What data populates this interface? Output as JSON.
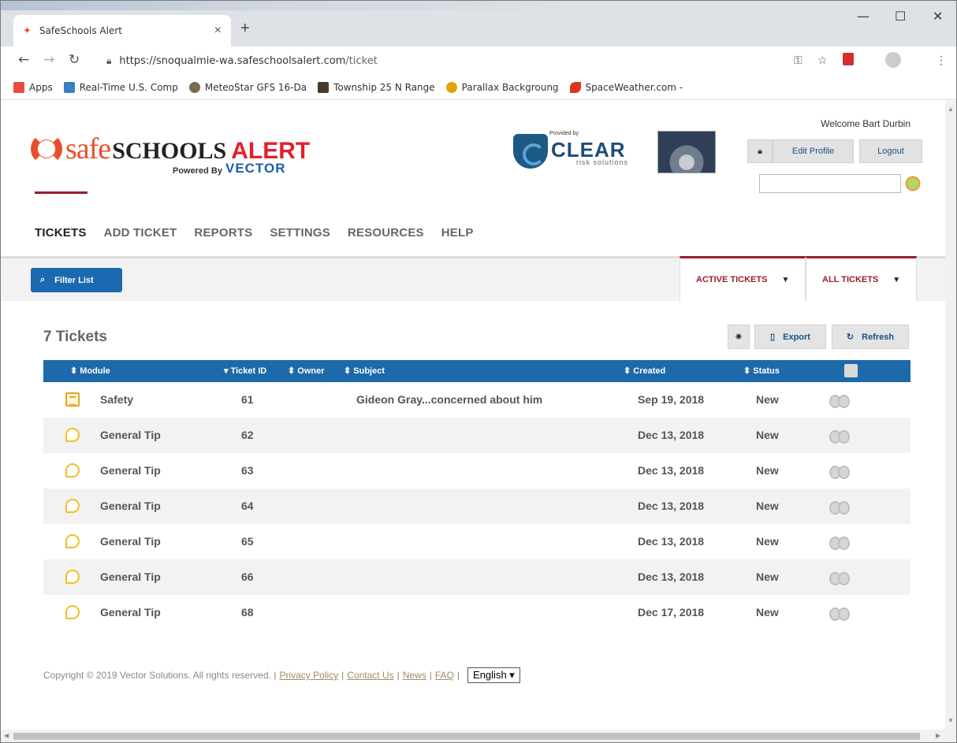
{
  "browser": {
    "tab_title": "SafeSchools Alert",
    "url_host": "https://snoqualmie-wa.safeschoolsalert.com",
    "url_path": "/ticket",
    "bookmarks": [
      {
        "label": "Apps",
        "color": "#e94b3c"
      },
      {
        "label": "Real-Time U.S. Comp",
        "color": "#3c7fc2"
      },
      {
        "label": "MeteoStar GFS 16-Da",
        "color": "#7a6a55"
      },
      {
        "label": "Township 25 N Range",
        "color": "#4a3a2a"
      },
      {
        "label": "Parallax Backgroung",
        "color": "#e2a400"
      },
      {
        "label": "SpaceWeather.com -",
        "color": "#d9361e"
      }
    ]
  },
  "header": {
    "logo_safe": "safe",
    "logo_schools": "SCHOOLS",
    "logo_alert": "ALERT",
    "powered_by": "Powered By",
    "vector": "VECTOR",
    "provided_by": "Provided by",
    "clear": "CLEAR",
    "risk": "risk solutions",
    "welcome": "Welcome Bart Durbin",
    "edit_profile": "Edit Profile",
    "logout": "Logout"
  },
  "nav": {
    "items": [
      "TICKETS",
      "ADD TICKET",
      "REPORTS",
      "SETTINGS",
      "RESOURCES",
      "HELP"
    ]
  },
  "subbar": {
    "filter_label": "Filter List",
    "active_tickets": "ACTIVE TICKETS",
    "all_tickets": "ALL TICKETS"
  },
  "list": {
    "count_label": "7 Tickets",
    "export_label": "Export",
    "refresh_label": "Refresh",
    "columns": {
      "module": "Module",
      "ticket_id": "Ticket ID",
      "owner": "Owner",
      "subject": "Subject",
      "created": "Created",
      "status": "Status"
    },
    "rows": [
      {
        "module": "Safety",
        "icon": "safety-icon",
        "id": "61",
        "owner": "",
        "subject": "Gideon Gray...concerned about him",
        "created": "Sep 19, 2018",
        "status": "New"
      },
      {
        "module": "General Tip",
        "icon": "speech-bubble-icon",
        "id": "62",
        "owner": "",
        "subject": "",
        "created": "Dec 13, 2018",
        "status": "New"
      },
      {
        "module": "General Tip",
        "icon": "speech-bubble-icon",
        "id": "63",
        "owner": "",
        "subject": "",
        "created": "Dec 13, 2018",
        "status": "New"
      },
      {
        "module": "General Tip",
        "icon": "speech-bubble-icon",
        "id": "64",
        "owner": "",
        "subject": "",
        "created": "Dec 13, 2018",
        "status": "New"
      },
      {
        "module": "General Tip",
        "icon": "speech-bubble-icon",
        "id": "65",
        "owner": "",
        "subject": "",
        "created": "Dec 13, 2018",
        "status": "New"
      },
      {
        "module": "General Tip",
        "icon": "speech-bubble-icon",
        "id": "66",
        "owner": "",
        "subject": "",
        "created": "Dec 13, 2018",
        "status": "New"
      },
      {
        "module": "General Tip",
        "icon": "speech-bubble-icon",
        "id": "68",
        "owner": "",
        "subject": "",
        "created": "Dec 17, 2018",
        "status": "New"
      }
    ]
  },
  "footer": {
    "copyright": "Copyright © 2019 Vector Solutions. All rights reserved. |",
    "privacy": "Privacy Policy",
    "contact": "Contact Us",
    "news": "News",
    "faq": "FAQ",
    "language": "English"
  },
  "colors": {
    "brand_red": "#9a1c2d",
    "brand_blue": "#1d6aaa"
  }
}
